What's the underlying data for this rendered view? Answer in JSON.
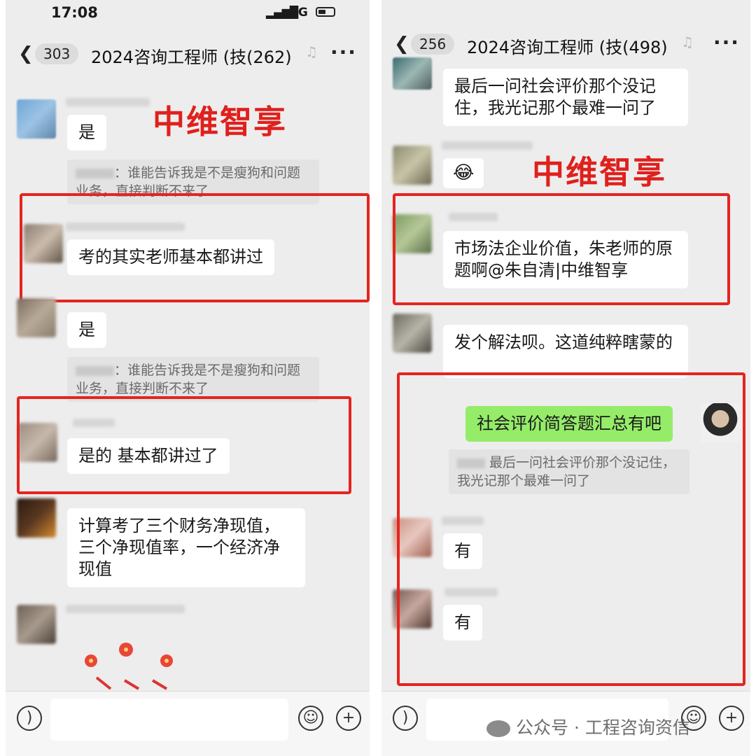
{
  "watermark_text": "中维智享",
  "left": {
    "status": {
      "time": "17:08",
      "network": "5G"
    },
    "nav": {
      "unread_count": "303",
      "title": "2024咨询工程师 (技",
      "member_count": "(262)"
    },
    "messages": [
      {
        "text": "是"
      },
      {
        "quote": "谁能告诉我是不是瘦狗和问题业务，直接判断不来了"
      },
      {
        "text": "考的其实老师基本都讲过"
      },
      {
        "text": "是"
      },
      {
        "quote": "谁能告诉我是不是瘦狗和问题业务，直接判断不来了"
      },
      {
        "text": "是的 基本都讲过了"
      },
      {
        "text": "计算考了三个财务净现值，三个净现值率，一个经济净现值"
      }
    ]
  },
  "right": {
    "nav": {
      "unread_count": "256",
      "title": "2024咨询工程师 (技",
      "member_count": "(498)"
    },
    "messages": [
      {
        "text": "最后一问社会评价那个没记住，我光记那个最难一问了"
      },
      {
        "emoji": "😂"
      },
      {
        "text": "市场法企业价值，朱老师的原题啊@朱自清|中维智享"
      },
      {
        "text": "发个解法呗。这道纯粹瞎蒙的"
      },
      {
        "text": "社会评价简答题汇总有吧",
        "self": true
      },
      {
        "quote": "最后一问社会评价那个没记住，我光记那个最难一问了"
      },
      {
        "text": "有"
      },
      {
        "text": "有"
      }
    ]
  },
  "footer_watermark": "公众号 · 工程咨询资信",
  "colors": {
    "box_red": "#e52420",
    "watermark_red": "#e0201c",
    "self_bubble": "#95ec69"
  }
}
